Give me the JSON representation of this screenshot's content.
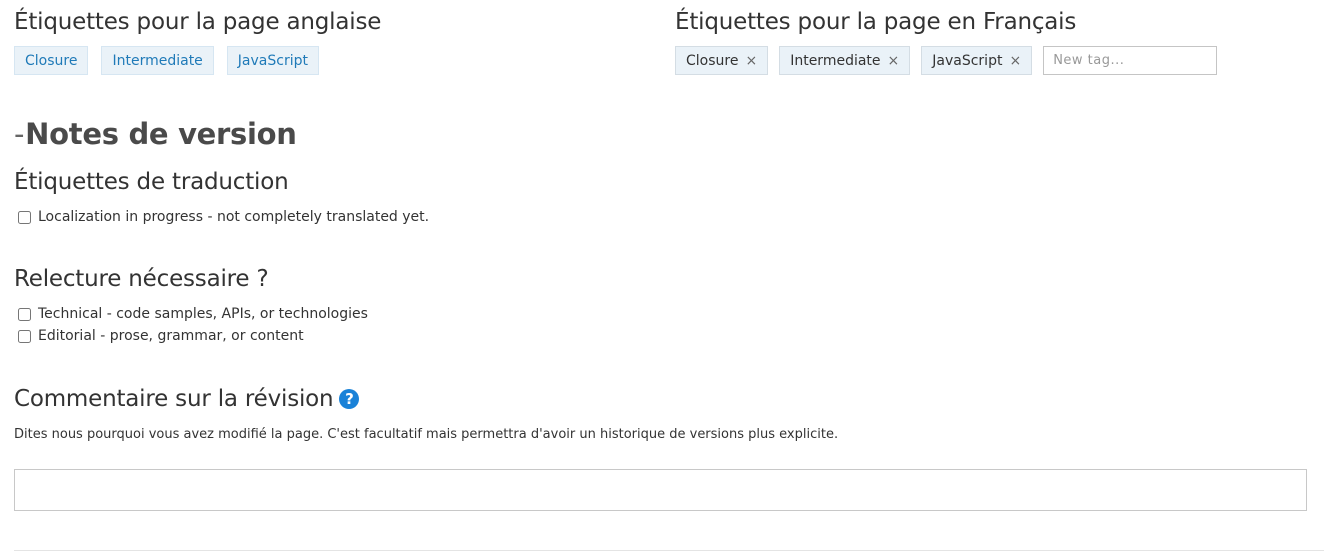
{
  "english_tags": {
    "heading": "Étiquettes pour la page anglaise",
    "tags": [
      "Closure",
      "Intermediate",
      "JavaScript"
    ]
  },
  "french_tags": {
    "heading": "Étiquettes pour la page en Français",
    "tags": [
      "Closure",
      "Intermediate",
      "JavaScript"
    ],
    "remove_glyph": "×",
    "new_tag_placeholder": "New tag..."
  },
  "release_notes": {
    "toggle": "-",
    "title": "Notes de version"
  },
  "translation_tags": {
    "heading": "Étiquettes de traduction",
    "options": [
      {
        "label": "Localization in progress - not completely translated yet.",
        "checked": false
      }
    ]
  },
  "review": {
    "heading": "Relecture nécessaire ?",
    "options": [
      {
        "label": "Technical - code samples, APIs, or technologies",
        "checked": false
      },
      {
        "label": "Editorial - prose, grammar, or content",
        "checked": false
      }
    ]
  },
  "revision_comment": {
    "heading": "Commentaire sur la révision",
    "help_glyph": "?",
    "hint": "Dites nous pourquoi vous avez modifié la page. C'est facultatif mais permettra d'avoir un historique de versions plus explicite.",
    "value": ""
  },
  "colors": {
    "tag_link": "#1f7ab8",
    "tag_bg": "#eaf2f8",
    "help_icon": "#1a82d8"
  },
  "icons": [
    "remove-tag-icon",
    "help-icon"
  ]
}
